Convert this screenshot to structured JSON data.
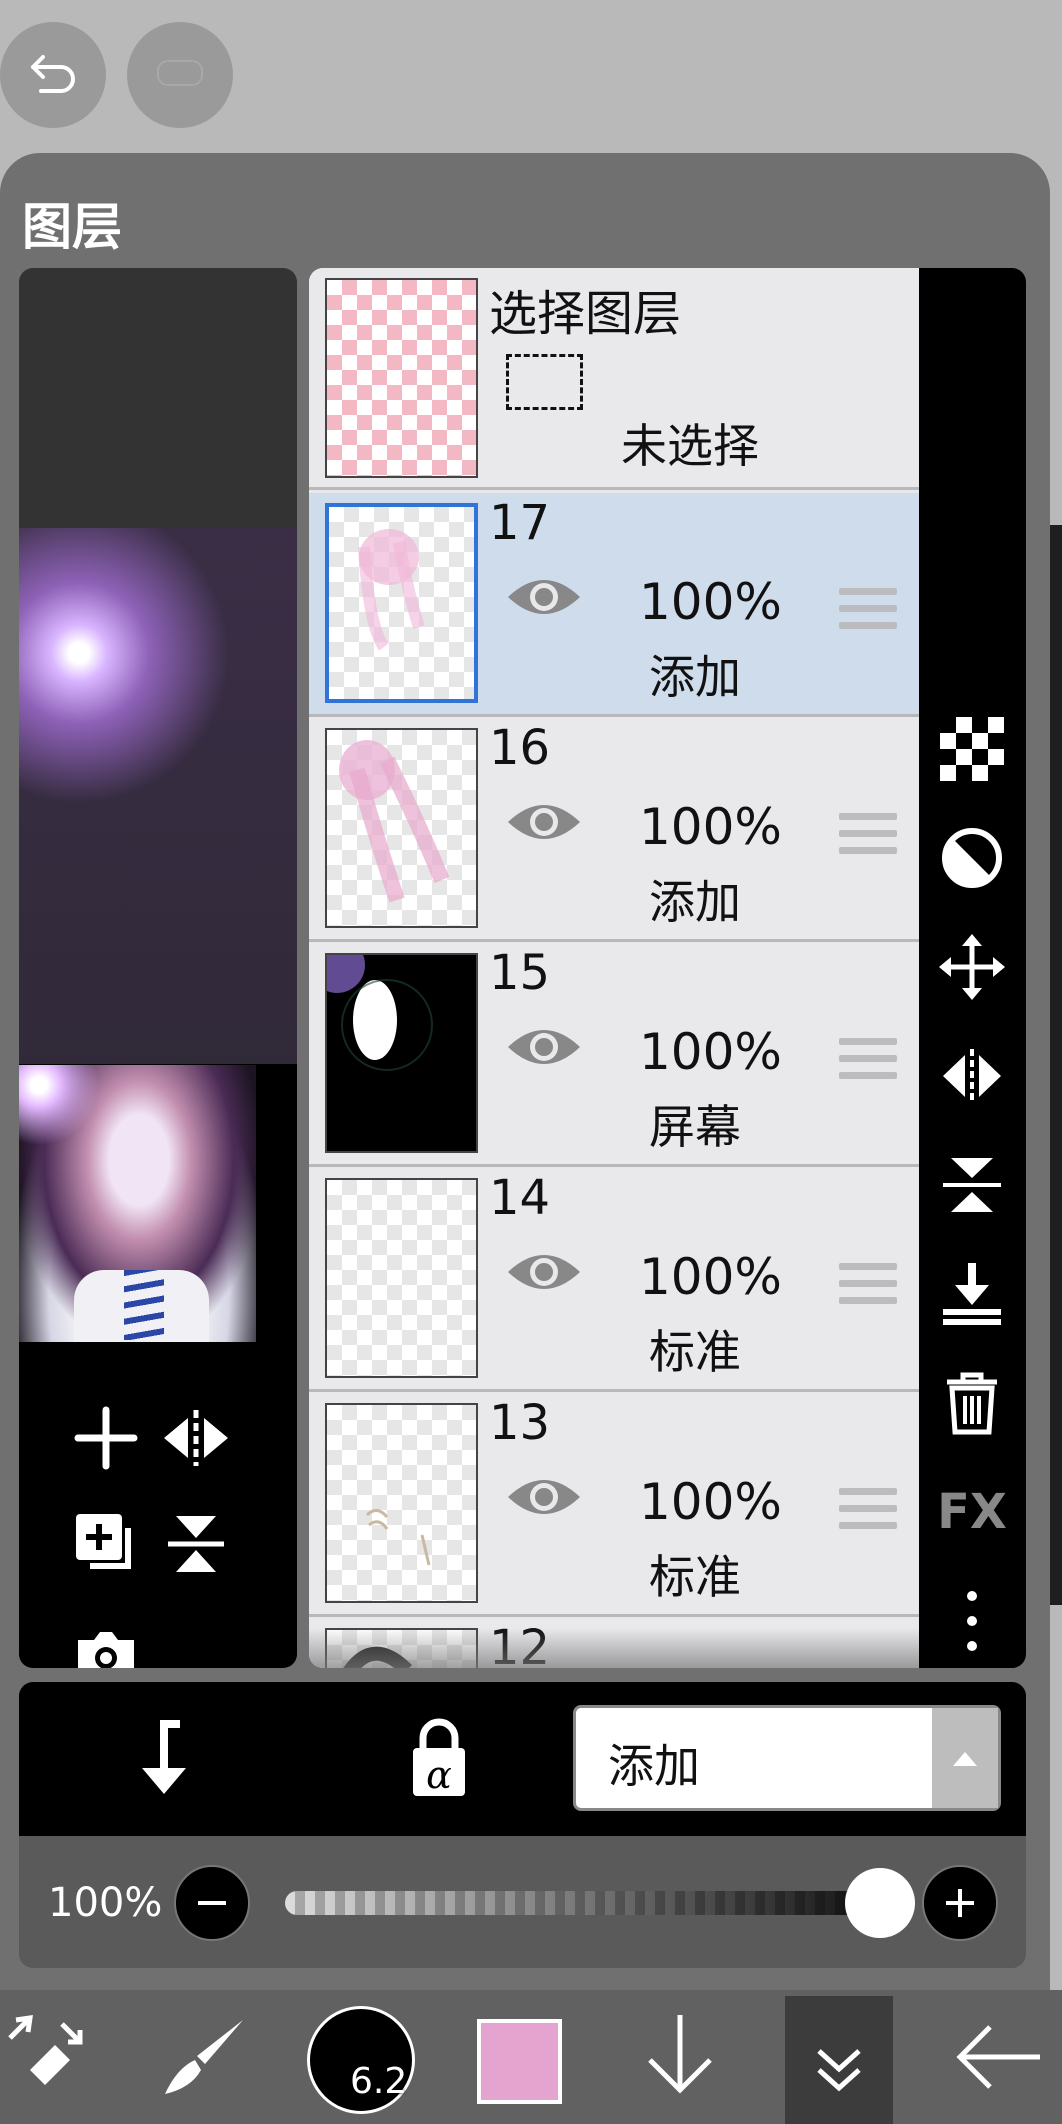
{
  "top_buttons": {
    "undo_icon": "undo-arrow-icon",
    "redo_icon": "redo-icon"
  },
  "panel": {
    "title": "图层"
  },
  "selection_layer": {
    "title": "选择图层",
    "status": "未选择"
  },
  "layers": [
    {
      "number": "17",
      "opacity": "100%",
      "blend": "添加",
      "selected": true
    },
    {
      "number": "16",
      "opacity": "100%",
      "blend": "添加",
      "selected": false
    },
    {
      "number": "15",
      "opacity": "100%",
      "blend": "屏幕",
      "selected": false
    },
    {
      "number": "14",
      "opacity": "100%",
      "blend": "标准",
      "selected": false
    },
    {
      "number": "13",
      "opacity": "100%",
      "blend": "标准",
      "selected": false
    },
    {
      "number": "12",
      "opacity": "",
      "blend": "",
      "selected": false
    }
  ],
  "side_tools": [
    "transparency-checker-icon",
    "contrast-icon",
    "move-icon",
    "flip-horizontal-icon",
    "flip-vertical-icon",
    "merge-down-icon",
    "trash-icon",
    "fx-icon",
    "more-vertical-icon"
  ],
  "side_fx_label": "FX",
  "layer_controls": {
    "blend_mode": "添加",
    "opacity_label": "100%",
    "opacity_value": 1.0
  },
  "toolbar": {
    "brush_size": "6.2",
    "color": "#e5a4cf"
  }
}
